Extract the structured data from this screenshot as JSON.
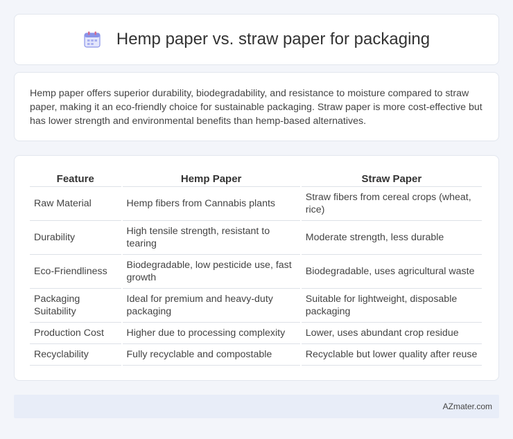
{
  "header": {
    "title": "Hemp paper vs. straw paper for packaging",
    "icon": "calendar-icon"
  },
  "summary": {
    "text": "Hemp paper offers superior durability, biodegradability, and resistance to moisture compared to straw paper, making it an eco-friendly choice for sustainable packaging. Straw paper is more cost-effective but has lower strength and environmental benefits than hemp-based alternatives."
  },
  "table": {
    "headers": [
      "Feature",
      "Hemp Paper",
      "Straw Paper"
    ],
    "rows": [
      [
        "Raw Material",
        "Hemp fibers from Cannabis plants",
        "Straw fibers from cereal crops (wheat, rice)"
      ],
      [
        "Durability",
        "High tensile strength, resistant to tearing",
        "Moderate strength, less durable"
      ],
      [
        "Eco-Friendliness",
        "Biodegradable, low pesticide use, fast growth",
        "Biodegradable, uses agricultural waste"
      ],
      [
        "Packaging Suitability",
        "Ideal for premium and heavy-duty packaging",
        "Suitable for lightweight, disposable packaging"
      ],
      [
        "Production Cost",
        "Higher due to processing complexity",
        "Lower, uses abundant crop residue"
      ],
      [
        "Recyclability",
        "Fully recyclable and compostable",
        "Recyclable but lower quality after reuse"
      ]
    ]
  },
  "footer": {
    "brand": "AZmater.com"
  }
}
